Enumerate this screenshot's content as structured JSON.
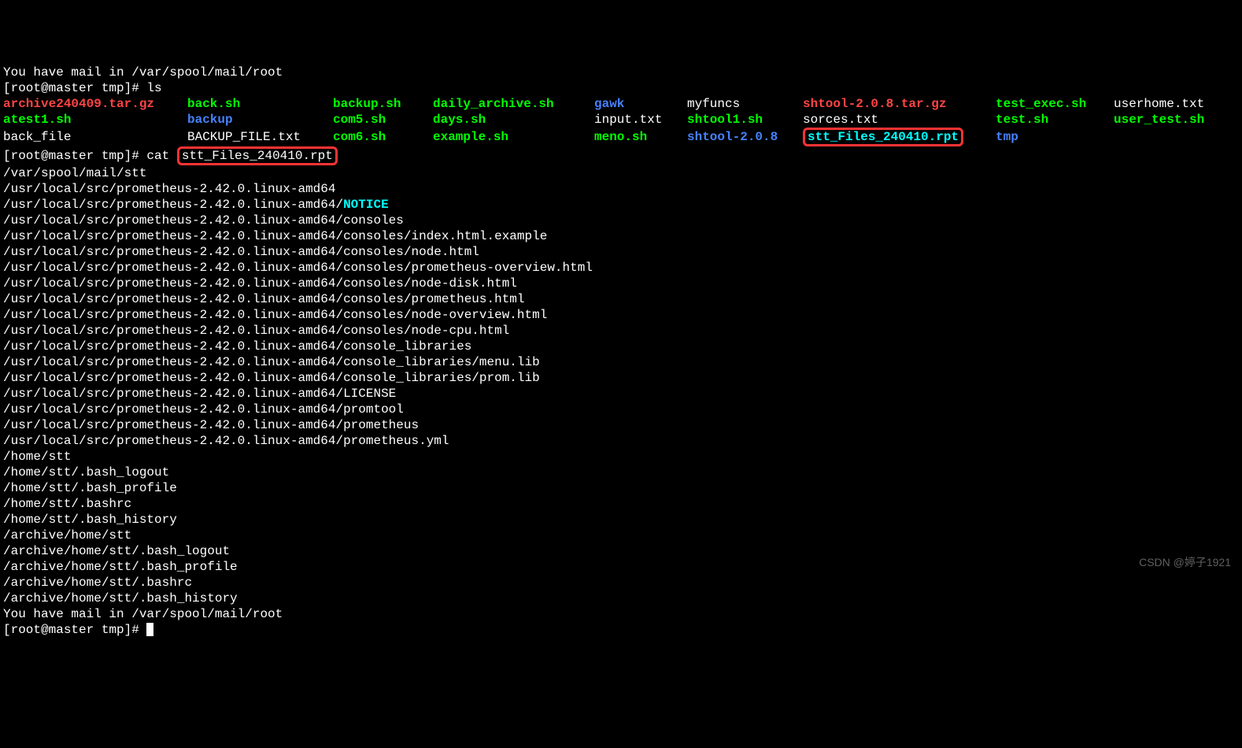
{
  "mail_top": "You have mail in /var/spool/mail/root",
  "prompt1_prefix": "[root@master tmp]# ",
  "cmd_ls": "ls",
  "ls_rows": [
    [
      {
        "txt": "archive240409.tar.gz",
        "cls": "red c1"
      },
      {
        "txt": "back.sh",
        "cls": "green c2"
      },
      {
        "txt": "backup.sh",
        "cls": "green c3"
      },
      {
        "txt": "daily_archive.sh",
        "cls": "green c4"
      },
      {
        "txt": "gawk",
        "cls": "blue c5"
      },
      {
        "txt": "myfuncs",
        "cls": "white c6"
      },
      {
        "txt": "shtool-2.0.8.tar.gz",
        "cls": "red c7"
      },
      {
        "txt": "test_exec.sh",
        "cls": "green c8"
      },
      {
        "txt": "userhome.txt",
        "cls": "white"
      }
    ],
    [
      {
        "txt": "atest1.sh",
        "cls": "green c1"
      },
      {
        "txt": "backup",
        "cls": "blue c2"
      },
      {
        "txt": "com5.sh",
        "cls": "green c3"
      },
      {
        "txt": "days.sh",
        "cls": "green c4"
      },
      {
        "txt": "input.txt",
        "cls": "white c5"
      },
      {
        "txt": "shtool1.sh",
        "cls": "green c6"
      },
      {
        "txt": "sorces.txt",
        "cls": "white c7"
      },
      {
        "txt": "test.sh",
        "cls": "green c8"
      },
      {
        "txt": "user_test.sh",
        "cls": "green"
      }
    ],
    [
      {
        "txt": "back_file",
        "cls": "white c1"
      },
      {
        "txt": "BACKUP_FILE.txt",
        "cls": "white c2"
      },
      {
        "txt": "com6.sh",
        "cls": "green c3"
      },
      {
        "txt": "example.sh",
        "cls": "green c4"
      },
      {
        "txt": "meno.sh",
        "cls": "green c5"
      },
      {
        "txt": "shtool-2.0.8",
        "cls": "blue c6"
      },
      {
        "txt": "stt_Files_240410.rpt",
        "cls": "cyan c7",
        "boxed": true
      },
      {
        "txt": "tmp",
        "cls": "blue c8"
      }
    ]
  ],
  "cmd_cat_prefix": "cat ",
  "cat_arg": "stt_Files_240410.rpt",
  "output_lines": [
    {
      "text": "/var/spool/mail/stt",
      "cls": ""
    },
    {
      "text": "/usr/local/src/prometheus-2.42.0.linux-amd64",
      "cls": ""
    },
    {
      "prefix": "/usr/local/src/prometheus-2.42.0.linux-amd64/",
      "suffix": "NOTICE",
      "suffixCls": "cyan"
    },
    {
      "text": "/usr/local/src/prometheus-2.42.0.linux-amd64/consoles",
      "cls": ""
    },
    {
      "text": "/usr/local/src/prometheus-2.42.0.linux-amd64/consoles/index.html.example",
      "cls": ""
    },
    {
      "text": "/usr/local/src/prometheus-2.42.0.linux-amd64/consoles/node.html",
      "cls": ""
    },
    {
      "text": "/usr/local/src/prometheus-2.42.0.linux-amd64/consoles/prometheus-overview.html",
      "cls": ""
    },
    {
      "text": "/usr/local/src/prometheus-2.42.0.linux-amd64/consoles/node-disk.html",
      "cls": ""
    },
    {
      "text": "/usr/local/src/prometheus-2.42.0.linux-amd64/consoles/prometheus.html",
      "cls": ""
    },
    {
      "text": "/usr/local/src/prometheus-2.42.0.linux-amd64/consoles/node-overview.html",
      "cls": ""
    },
    {
      "text": "/usr/local/src/prometheus-2.42.0.linux-amd64/consoles/node-cpu.html",
      "cls": ""
    },
    {
      "text": "/usr/local/src/prometheus-2.42.0.linux-amd64/console_libraries",
      "cls": ""
    },
    {
      "text": "/usr/local/src/prometheus-2.42.0.linux-amd64/console_libraries/menu.lib",
      "cls": ""
    },
    {
      "text": "/usr/local/src/prometheus-2.42.0.linux-amd64/console_libraries/prom.lib",
      "cls": ""
    },
    {
      "text": "/usr/local/src/prometheus-2.42.0.linux-amd64/LICENSE",
      "cls": ""
    },
    {
      "text": "/usr/local/src/prometheus-2.42.0.linux-amd64/promtool",
      "cls": ""
    },
    {
      "text": "/usr/local/src/prometheus-2.42.0.linux-amd64/prometheus",
      "cls": ""
    },
    {
      "text": "/usr/local/src/prometheus-2.42.0.linux-amd64/prometheus.yml",
      "cls": ""
    },
    {
      "text": "/home/stt",
      "cls": ""
    },
    {
      "text": "/home/stt/.bash_logout",
      "cls": ""
    },
    {
      "text": "/home/stt/.bash_profile",
      "cls": ""
    },
    {
      "text": "/home/stt/.bashrc",
      "cls": ""
    },
    {
      "text": "/home/stt/.bash_history",
      "cls": ""
    },
    {
      "text": "/archive/home/stt",
      "cls": ""
    },
    {
      "text": "/archive/home/stt/.bash_logout",
      "cls": ""
    },
    {
      "text": "/archive/home/stt/.bash_profile",
      "cls": ""
    },
    {
      "text": "/archive/home/stt/.bashrc",
      "cls": ""
    },
    {
      "text": "/archive/home/stt/.bash_history",
      "cls": ""
    },
    {
      "text": "You have mail in /var/spool/mail/root",
      "cls": ""
    }
  ],
  "final_prompt": "[root@master tmp]# ",
  "watermark": "CSDN @婷子1921"
}
